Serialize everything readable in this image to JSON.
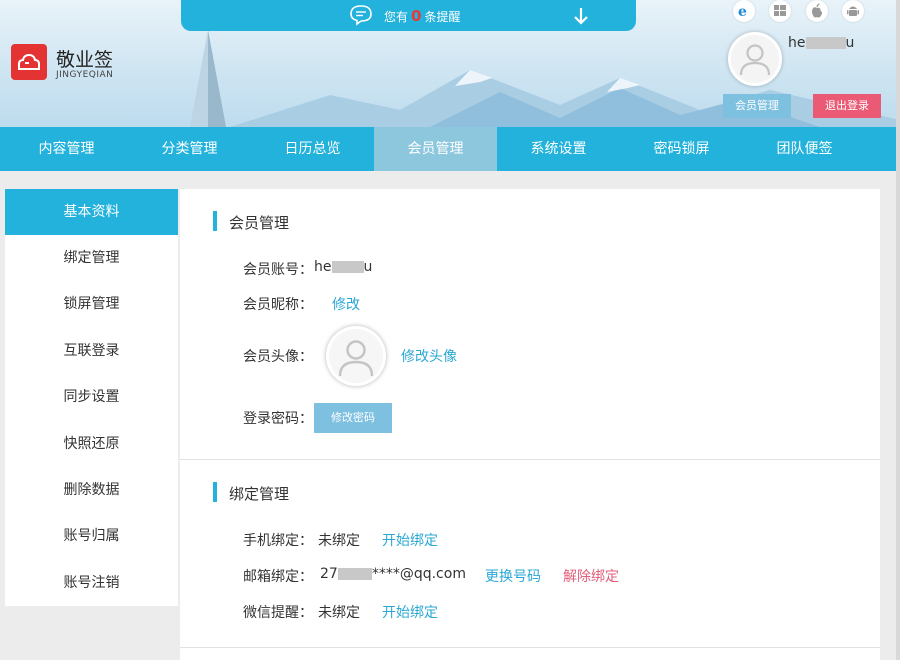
{
  "header": {
    "logo_title": "敬业签",
    "logo_subtitle": "JINGYEQIAN",
    "notify_prefix": "您有",
    "notify_count": "0",
    "notify_suffix": "条提醒",
    "username_visible": "he",
    "username_tail": "u",
    "member_button": "会员管理",
    "logout_button": "退出登录",
    "platforms": [
      "ie-icon",
      "windows-icon",
      "apple-icon",
      "android-icon"
    ]
  },
  "nav": {
    "items": [
      "内容管理",
      "分类管理",
      "日历总览",
      "会员管理",
      "系统设置",
      "密码锁屏",
      "团队便签"
    ],
    "active": "会员管理"
  },
  "sidebar": {
    "items": [
      "基本资料",
      "绑定管理",
      "锁屏管理",
      "互联登录",
      "同步设置",
      "快照还原",
      "删除数据",
      "账号归属",
      "账号注销"
    ],
    "active": "基本资料"
  },
  "member": {
    "title": "会员管理",
    "account_label": "会员账号：",
    "account_visible": "he",
    "account_tail": "u",
    "nickname_label": "会员昵称：",
    "nickname_action": "修改",
    "avatar_label": "会员头像：",
    "avatar_action": "修改头像",
    "password_label": "登录密码：",
    "password_button": "修改密码"
  },
  "binding": {
    "title": "绑定管理",
    "phone_label": "手机绑定：",
    "phone_status": "未绑定",
    "phone_action": "开始绑定",
    "email_label": "邮箱绑定：",
    "email_prefix": "27",
    "email_suffix": "****@qq.com",
    "email_change": "更换号码",
    "email_unbind": "解除绑定",
    "wechat_label": "微信提醒：",
    "wechat_status": "未绑定",
    "wechat_action": "开始绑定"
  },
  "colors": {
    "accent": "#22b2db",
    "nav_active": "#8cc7de",
    "link": "#2ba7d4",
    "danger": "#ea5a74",
    "logo": "#e33333"
  }
}
